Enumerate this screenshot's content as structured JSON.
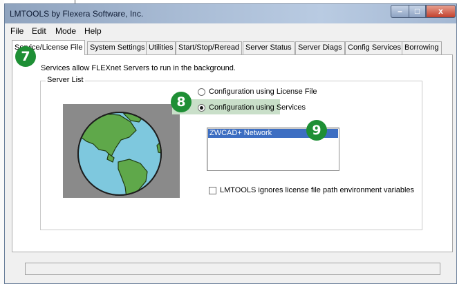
{
  "window": {
    "title": "LMTOOLS by Flexera Software, Inc.",
    "min_symbol": "–",
    "max_symbol": "□",
    "close_symbol": "x"
  },
  "menu": [
    "File",
    "Edit",
    "Mode",
    "Help"
  ],
  "tabs": [
    "Service/License File",
    "System Settings",
    "Utilities",
    "Start/Stop/Reread",
    "Server Status",
    "Server Diags",
    "Config Services",
    "Borrowing"
  ],
  "panel": {
    "hint": "Services allow FLEXnet Servers to run in the background.",
    "group_label": "Server List",
    "radio_license_file": "Configuration using License File",
    "radio_services": "Configuration using Services",
    "services_list": [
      "ZWCAD+ Network"
    ],
    "checkbox_label": "LMTOOLS ignores license file path environment variables"
  },
  "badges": [
    "7",
    "8",
    "9"
  ],
  "colors": {
    "badge": "#1e8f35",
    "highlight": "#c9dfc9",
    "selection": "#3d6ec2"
  },
  "icons": [
    "globe-icon",
    "minimize-icon",
    "maximize-icon",
    "close-icon"
  ]
}
